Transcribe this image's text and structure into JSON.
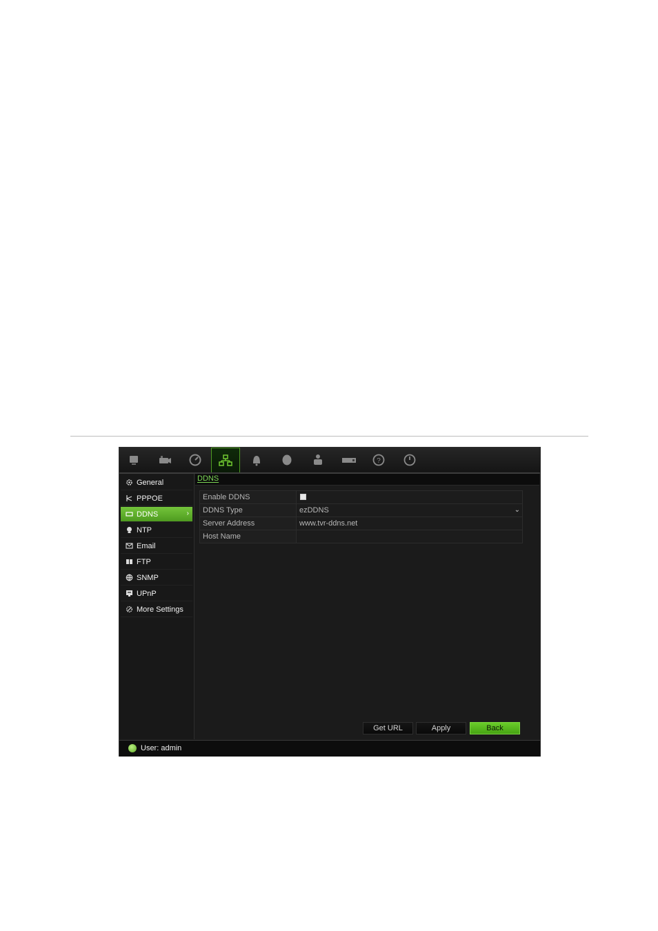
{
  "toolbar": {
    "items": [
      {
        "icon": "monitor-icon",
        "active": false
      },
      {
        "icon": "camera-icon",
        "active": false
      },
      {
        "icon": "clock-icon",
        "active": false
      },
      {
        "icon": "network-icon",
        "active": true
      },
      {
        "icon": "alarm-bell-icon",
        "active": false
      },
      {
        "icon": "storage-disk-icon",
        "active": false
      },
      {
        "icon": "user-icon",
        "active": false
      },
      {
        "icon": "device-icon",
        "active": false
      },
      {
        "icon": "help-icon",
        "active": false
      },
      {
        "icon": "power-icon",
        "active": false
      }
    ],
    "accent": "#6cc02f"
  },
  "sidebar": {
    "items": [
      {
        "label": "General",
        "icon": "gear-icon",
        "active": false
      },
      {
        "label": "PPPOE",
        "icon": "pppoe-icon",
        "active": false
      },
      {
        "label": "DDNS",
        "icon": "ddns-icon",
        "active": true
      },
      {
        "label": "NTP",
        "icon": "ntp-icon",
        "active": false
      },
      {
        "label": "Email",
        "icon": "email-icon",
        "active": false
      },
      {
        "label": "FTP",
        "icon": "ftp-icon",
        "active": false
      },
      {
        "label": "SNMP",
        "icon": "globe-icon",
        "active": false
      },
      {
        "label": "UPnP",
        "icon": "upnp-icon",
        "active": false
      },
      {
        "label": "More Settings",
        "icon": "settings-icon",
        "active": false
      }
    ],
    "active_arrow": "›"
  },
  "content": {
    "tab": "DDNS",
    "form": {
      "enable_ddns": {
        "label": "Enable DDNS",
        "checked": false
      },
      "ddns_type": {
        "label": "DDNS Type",
        "value": "ezDDNS",
        "chevron": "⌄"
      },
      "server_address": {
        "label": "Server Address",
        "value": "www.tvr-ddns.net"
      },
      "host_name": {
        "label": "Host Name",
        "value": ""
      }
    },
    "buttons": {
      "get_url": "Get URL",
      "apply": "Apply",
      "back": "Back"
    }
  },
  "status": {
    "user_text": "User: admin"
  }
}
